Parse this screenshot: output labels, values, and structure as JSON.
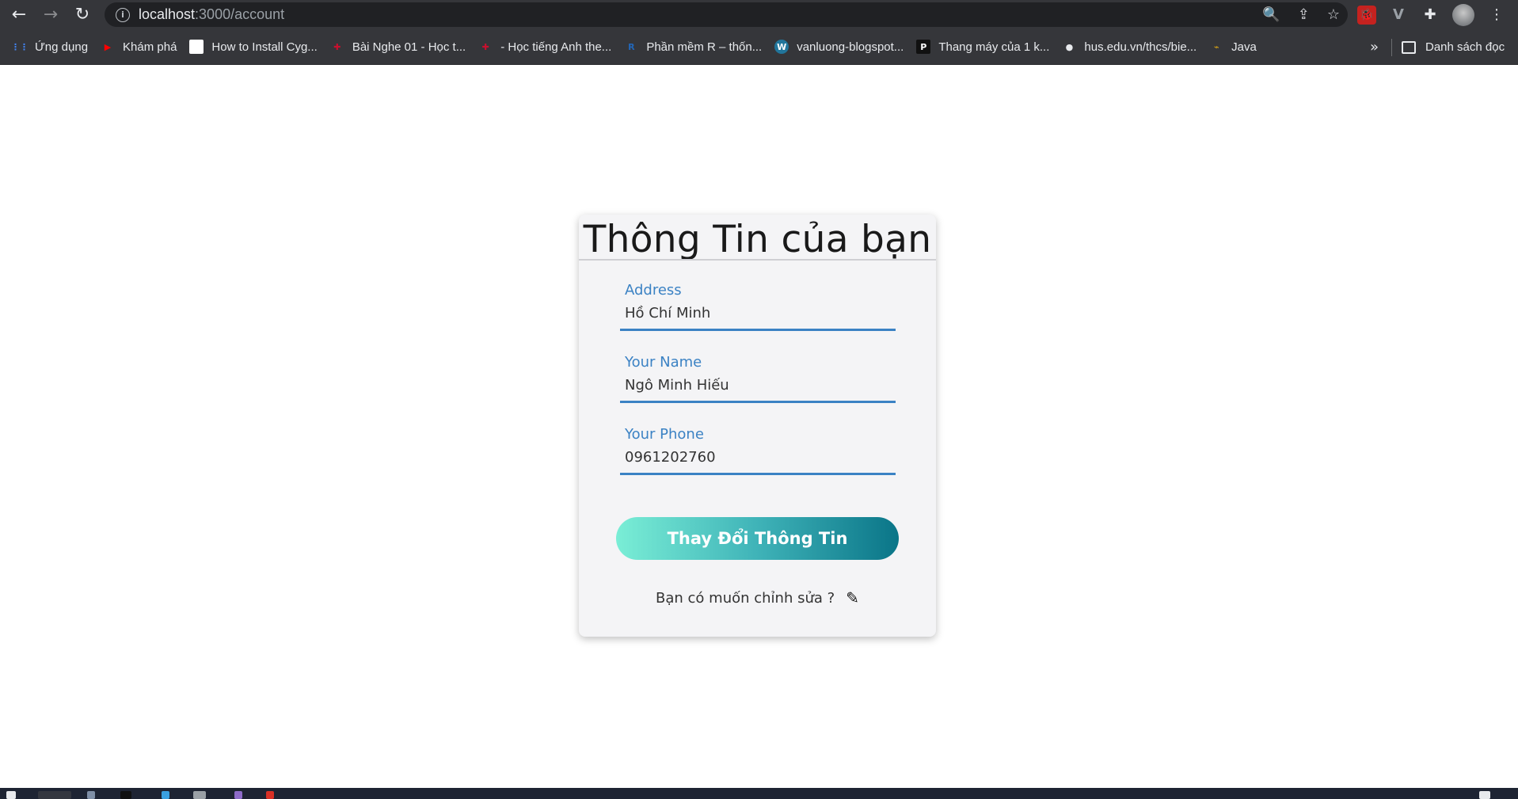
{
  "browser": {
    "url_host": "localhost",
    "url_path": ":3000/account",
    "nav": {
      "back": "←",
      "forward": "→",
      "reload": "↻"
    },
    "omnibox_icons": {
      "zoom": "🔍",
      "share": "⇪",
      "star": "☆"
    },
    "extensions": {
      "ext1": "🐞",
      "ext2": "V",
      "puzzle": "✚",
      "menu": "⋮"
    }
  },
  "bookmarks": {
    "items": [
      {
        "label": "Ứng dụng",
        "icon": "apps-grid-icon",
        "glyph": "⋮⋮",
        "color": "#4285f4"
      },
      {
        "label": "Khám phá",
        "icon": "youtube-icon",
        "glyph": "▶",
        "color": "#ff0000"
      },
      {
        "label": "How to Install Cyg...",
        "icon": "page-icon",
        "glyph": "",
        "color": "#ffffff"
      },
      {
        "label": "Bài Nghe 01 - Học t...",
        "icon": "uk-flag-icon",
        "glyph": "✚",
        "color": "#c8102e"
      },
      {
        "label": "- Học tiếng Anh the...",
        "icon": "uk-flag-icon",
        "glyph": "✚",
        "color": "#c8102e"
      },
      {
        "label": "Phần mềm R – thốn...",
        "icon": "r-logo-icon",
        "glyph": "R",
        "color": "#2266b8"
      },
      {
        "label": "vanluong-blogspot...",
        "icon": "wordpress-icon",
        "glyph": "W",
        "color": "#ffffff"
      },
      {
        "label": "Thang máy của 1 k...",
        "icon": "pinterest-icon",
        "glyph": "P",
        "color": "#111111"
      },
      {
        "label": "hus.edu.vn/thcs/bie...",
        "icon": "globe-icon",
        "glyph": "●",
        "color": "#e8eaed"
      },
      {
        "label": "Java",
        "icon": "java-icon",
        "glyph": "⌁",
        "color": "#d4a017"
      }
    ],
    "more": "»",
    "reading_list": "Danh sách đọc"
  },
  "card": {
    "title": "Thông Tin của bạn",
    "fields": [
      {
        "label": "Address",
        "value": "Hồ Chí Minh"
      },
      {
        "label": "Your Name",
        "value": "Ngô Minh Hiếu"
      },
      {
        "label": "Your Phone",
        "value": "0961202760"
      }
    ],
    "submit_label": "Thay Đổi Thông Tin",
    "edit_prompt": "Bạn có muốn chỉnh sửa ?",
    "edit_icon": "✎"
  },
  "colors": {
    "accent": "#3b82c4",
    "button_start": "#7aeed6",
    "button_end": "#0a7588"
  }
}
